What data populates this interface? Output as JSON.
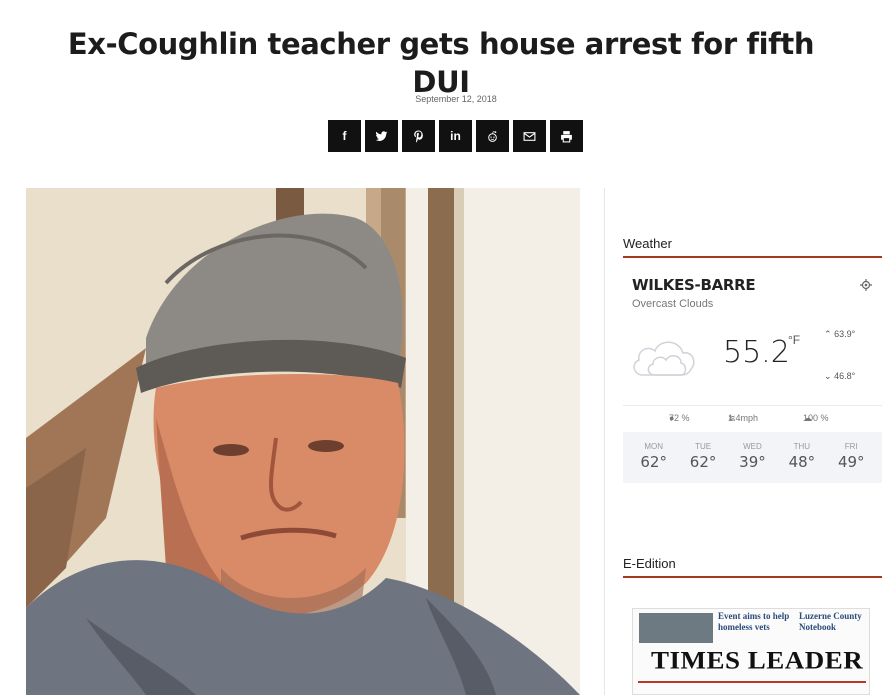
{
  "article": {
    "title": "Ex-Coughlin teacher gets house arrest for fifth DUI",
    "date": "September 12, 2018"
  },
  "share": {
    "buttons": [
      {
        "icon": "facebook-icon",
        "label": "f"
      },
      {
        "icon": "twitter-icon",
        "label": ""
      },
      {
        "icon": "pinterest-icon",
        "label": ""
      },
      {
        "icon": "linkedin-icon",
        "label": "in"
      },
      {
        "icon": "reddit-icon",
        "label": ""
      },
      {
        "icon": "email-icon",
        "label": ""
      },
      {
        "icon": "print-icon",
        "label": ""
      }
    ]
  },
  "sidebar": {
    "weather": {
      "heading": "Weather",
      "city": "WILKES-BARRE",
      "description": "Overcast Clouds",
      "temp": "55.2",
      "unit": "°F",
      "high": "63.9°",
      "low": "46.8°",
      "humidity": "72 %",
      "wind": "1.4mph",
      "clouds": "100 %",
      "forecast": [
        {
          "day": "MON",
          "temp": "62°"
        },
        {
          "day": "TUE",
          "temp": "62°"
        },
        {
          "day": "WED",
          "temp": "39°"
        },
        {
          "day": "THU",
          "temp": "48°"
        },
        {
          "day": "FRI",
          "temp": "49°"
        }
      ]
    },
    "edition": {
      "heading": "E-Edition",
      "headline1": "Event aims to help homeless vets",
      "headline2": "Luzerne County Notebook",
      "logo": "TIMES LEADER"
    }
  },
  "colors": {
    "accent": "#a23a26",
    "share_bg": "#111111"
  }
}
